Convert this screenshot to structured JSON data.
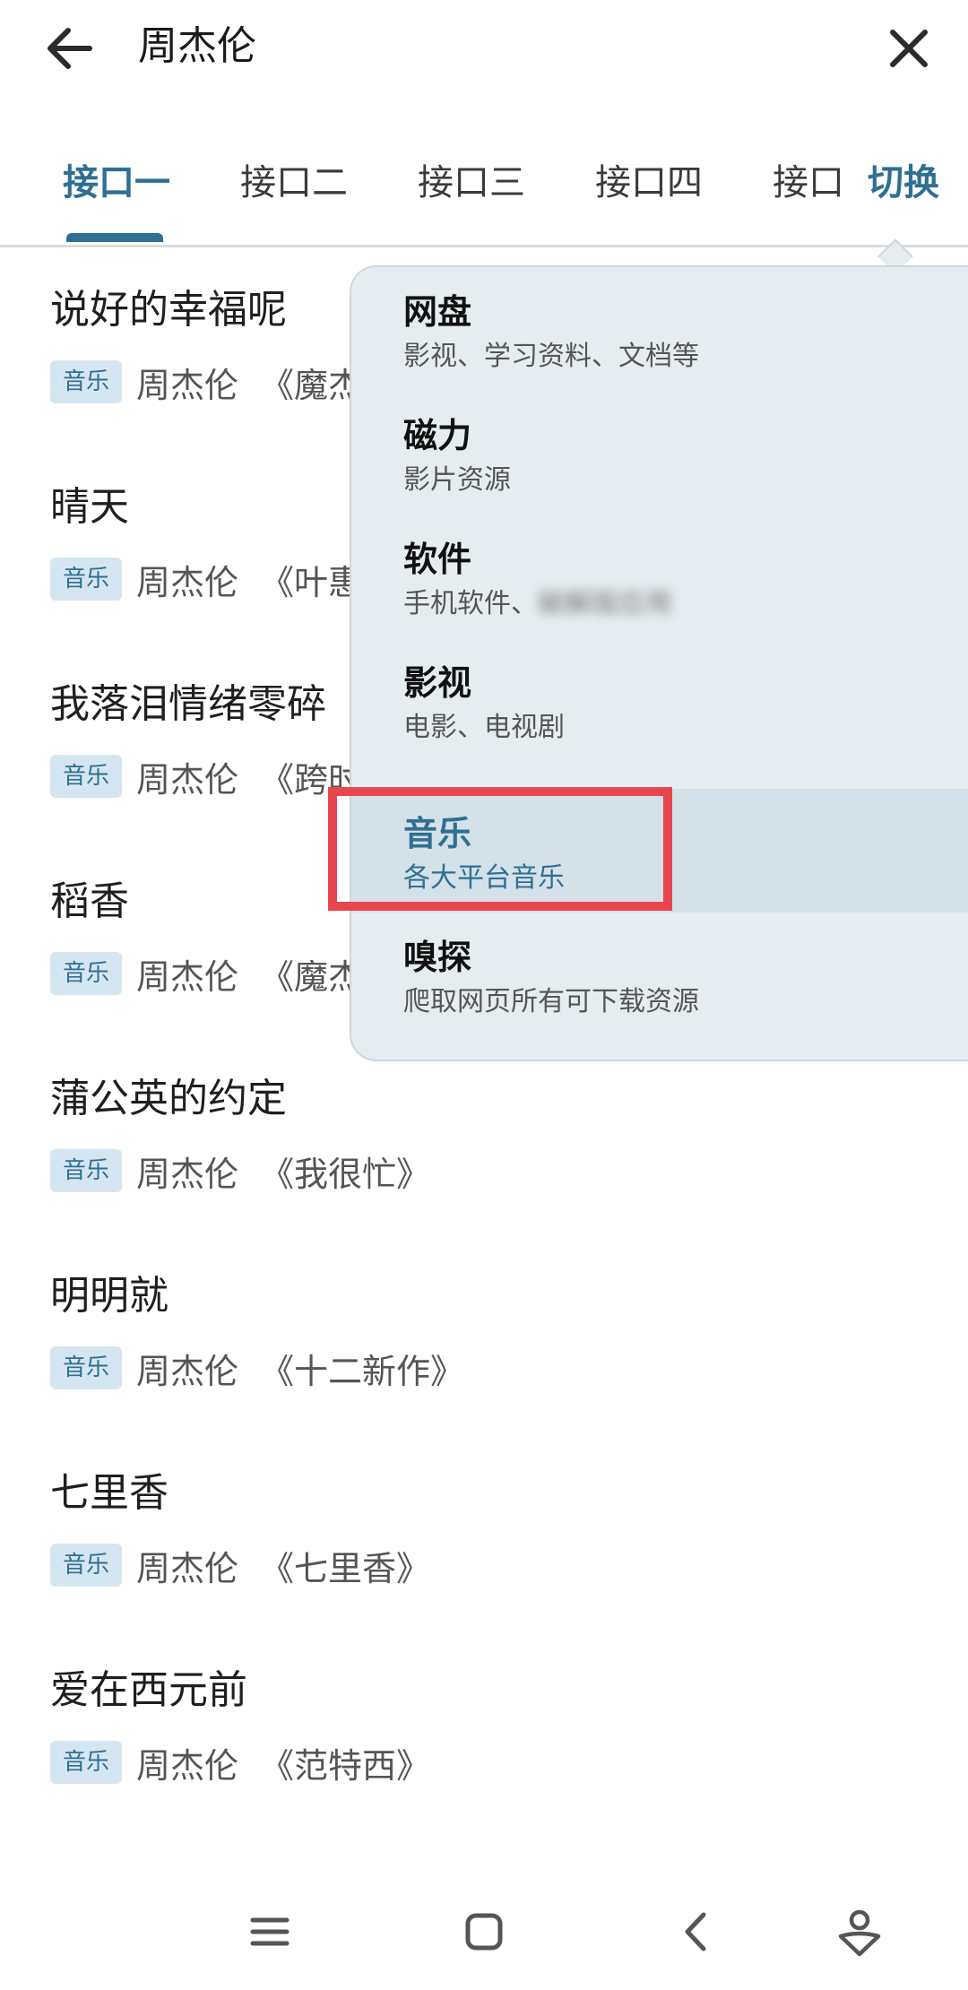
{
  "header": {
    "search_text": "周杰伦"
  },
  "tabs": {
    "items": [
      "接口一",
      "接口二",
      "接口三",
      "接口四",
      "接口"
    ],
    "active_index": 0,
    "switch_label": "切换"
  },
  "songs": [
    {
      "title": "说好的幸福呢",
      "tag": "音乐",
      "artist": "周杰伦",
      "album": "《魔杰座》"
    },
    {
      "title": "晴天",
      "tag": "音乐",
      "artist": "周杰伦",
      "album": "《叶惠美》"
    },
    {
      "title": "我落泪情绪零碎",
      "tag": "音乐",
      "artist": "周杰伦",
      "album": "《跨时代》"
    },
    {
      "title": "稻香",
      "tag": "音乐",
      "artist": "周杰伦",
      "album": "《魔杰座》"
    },
    {
      "title": "蒲公英的约定",
      "tag": "音乐",
      "artist": "周杰伦",
      "album": "《我很忙》"
    },
    {
      "title": "明明就",
      "tag": "音乐",
      "artist": "周杰伦",
      "album": "《十二新作》"
    },
    {
      "title": "七里香",
      "tag": "音乐",
      "artist": "周杰伦",
      "album": "《七里香》"
    },
    {
      "title": "爱在西元前",
      "tag": "音乐",
      "artist": "周杰伦",
      "album": "《范特西》"
    }
  ],
  "menu": {
    "items": [
      {
        "label": "网盘",
        "desc": "影视、学习资料、文档等"
      },
      {
        "label": "磁力",
        "desc": "影片资源"
      },
      {
        "label": "软件",
        "desc": "手机软件、",
        "desc_blurred": "破解版应用"
      },
      {
        "label": "影视",
        "desc": "电影、电视剧"
      },
      {
        "label": "音乐",
        "desc": "各大平台音乐"
      },
      {
        "label": "嗅探",
        "desc": "爬取网页所有可下载资源"
      }
    ],
    "selected_index": 4
  },
  "colors": {
    "accent": "#2e6f92",
    "tag_bg": "#d6e6f1",
    "menu_bg": "#e6edf1",
    "highlight": "#e8464f"
  },
  "icons": {
    "back": "arrow-left-icon",
    "close": "close-icon",
    "nav": [
      "menu-lines-icon",
      "square-home-icon",
      "chevron-back-icon",
      "assistant-icon"
    ]
  }
}
